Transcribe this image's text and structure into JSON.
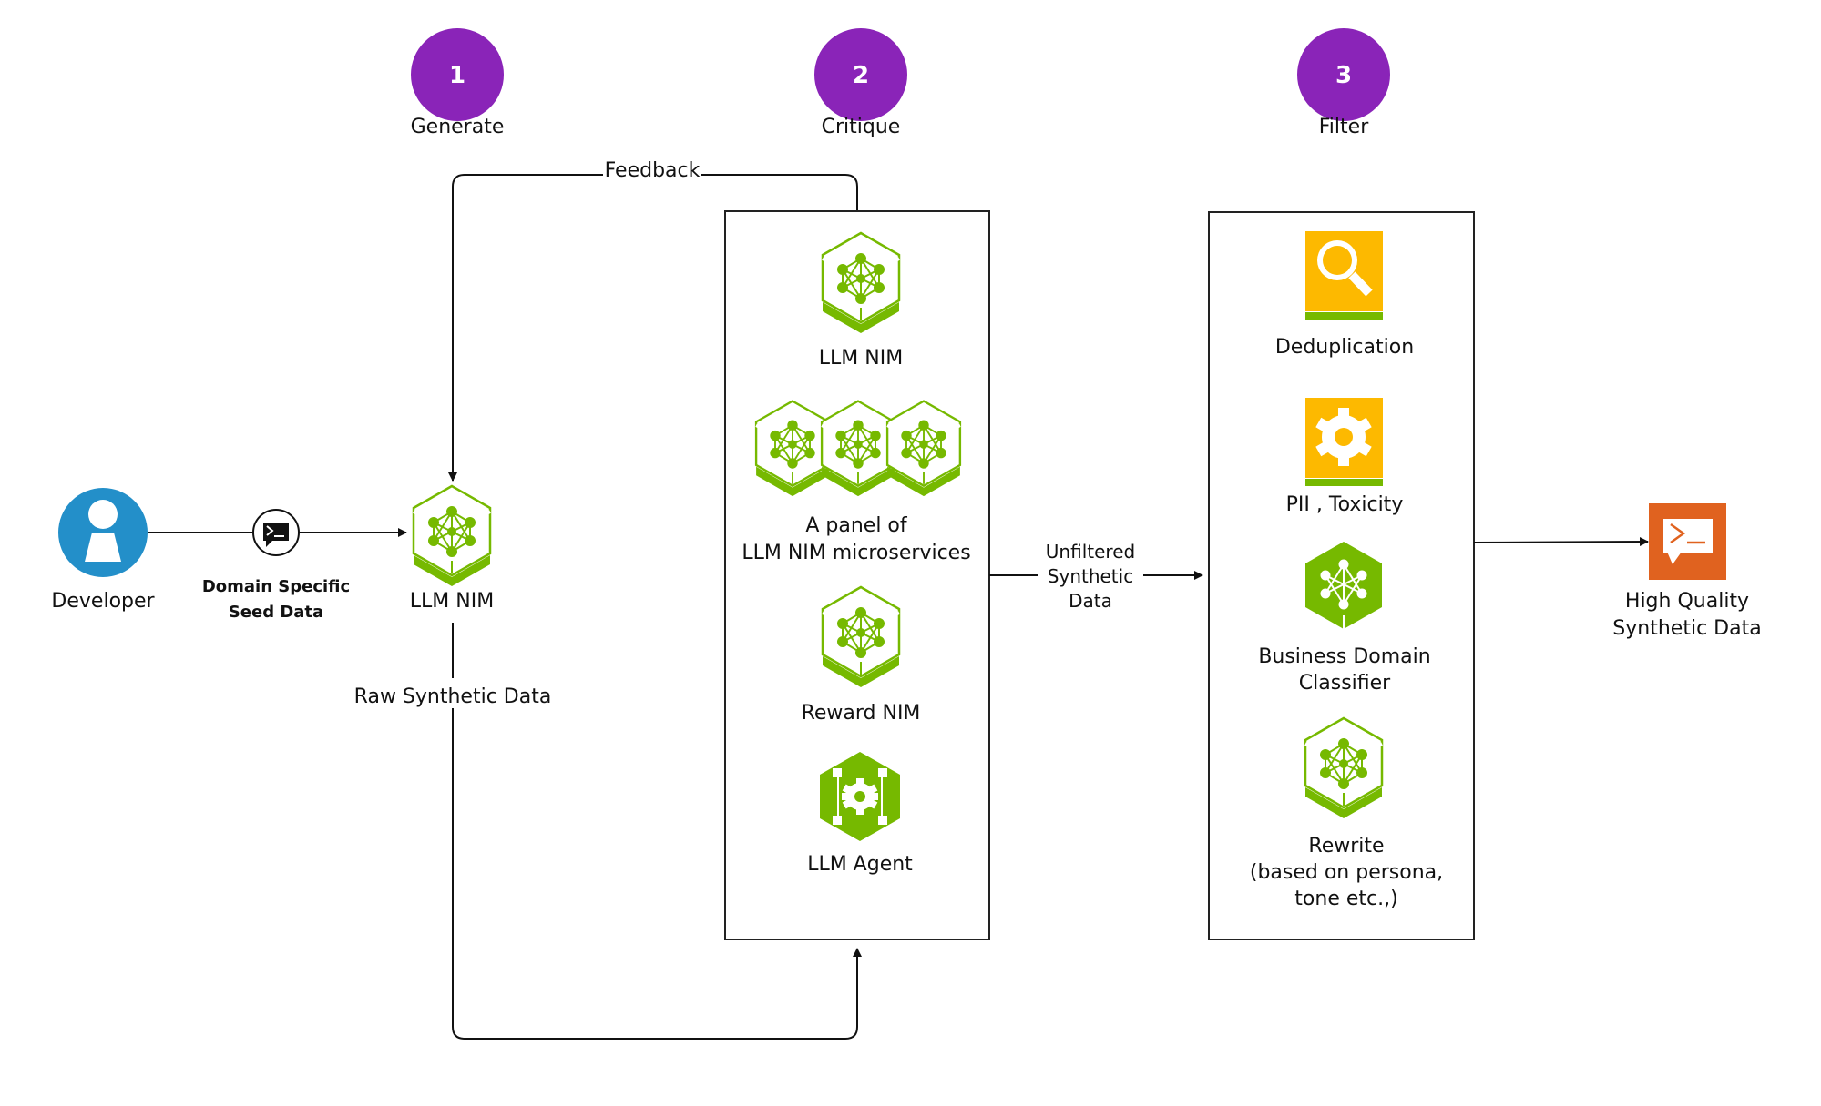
{
  "colors": {
    "step_purple": "#8a24b8",
    "nvidia_green": "#76b900",
    "developer_blue": "#238fc9",
    "filter_yellow": "#fdb900",
    "output_orange": "#e0621f",
    "line": "#111111"
  },
  "steps": [
    {
      "number": "1",
      "label": "Generate"
    },
    {
      "number": "2",
      "label": "Critique"
    },
    {
      "number": "3",
      "label": "Filter"
    }
  ],
  "developer": {
    "label": "Developer",
    "icon": "user-icon"
  },
  "seed": {
    "line1": "Domain Specific",
    "line2": "Seed Data",
    "icon": "terminal-chat-icon"
  },
  "generator": {
    "label": "LLM NIM",
    "icon": "nim-hex-icon"
  },
  "edges": {
    "feedback": "Feedback",
    "raw": "Raw Synthetic Data",
    "unfiltered": [
      "Unfiltered",
      "Synthetic",
      "Data"
    ]
  },
  "critique": {
    "items": [
      {
        "lines": [
          "LLM NIM"
        ],
        "icon": "nim-hex-icon"
      },
      {
        "lines": [
          "A panel of",
          "LLM NIM microservices"
        ],
        "icon": "nim-panel-icon"
      },
      {
        "lines": [
          "Reward NIM"
        ],
        "icon": "nim-hex-icon"
      },
      {
        "lines": [
          "LLM Agent"
        ],
        "icon": "agent-gear-icon"
      }
    ]
  },
  "filter": {
    "items": [
      {
        "lines": [
          "Deduplication"
        ],
        "icon": "magnifier-icon"
      },
      {
        "lines": [
          "PII , Toxicity"
        ],
        "icon": "gear-icon"
      },
      {
        "lines": [
          "Business Domain",
          "Classifier"
        ],
        "icon": "nim-hex-solid-icon"
      },
      {
        "lines": [
          "Rewrite",
          "(based on persona,",
          "tone etc.,)"
        ],
        "icon": "nim-hex-icon"
      }
    ]
  },
  "output": {
    "line1": "High Quality",
    "line2": "Synthetic Data",
    "icon": "terminal-chat-icon"
  }
}
